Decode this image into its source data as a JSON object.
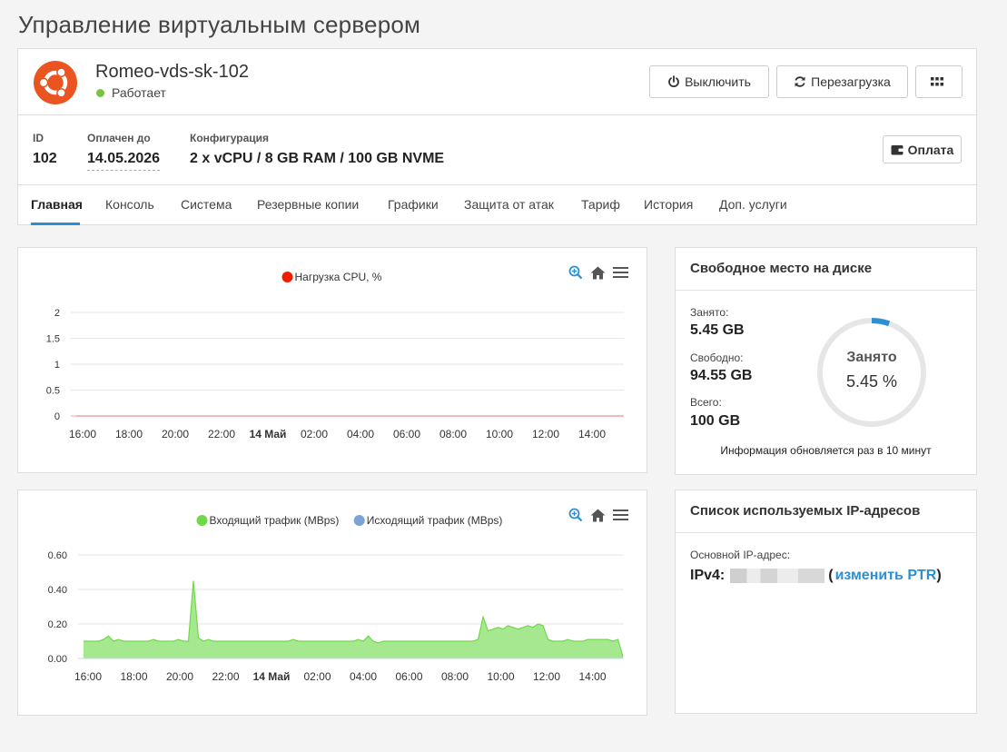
{
  "page": {
    "title": "Управление виртуальным сервером"
  },
  "server": {
    "name": "Romeo-vds-sk-102",
    "status": "Работает",
    "status_color": "#7cc142",
    "os_icon": "ubuntu-logo",
    "os_color": "#e95420"
  },
  "actions": {
    "power_off": "Выключить",
    "reboot": "Перезагрузка",
    "more_icon": "grid-icon",
    "pay": "Оплата"
  },
  "info": {
    "id_label": "ID",
    "id_value": "102",
    "paid_label": "Оплачен до",
    "paid_value": "14.05.2026",
    "config_label": "Конфигурация",
    "config_value": "2 x vCPU / 8 GB RAM / 100 GB NVME"
  },
  "tabs": [
    {
      "label": "Главная",
      "active": true
    },
    {
      "label": "Консоль"
    },
    {
      "label": "Система"
    },
    {
      "label": "Резервные копии"
    },
    {
      "label": "Графики"
    },
    {
      "label": "Защита от атак"
    },
    {
      "label": "Тариф"
    },
    {
      "label": "История"
    },
    {
      "label": "Доп. услуги"
    }
  ],
  "accent_color": "#2a8fd3",
  "chart_data": [
    {
      "type": "line",
      "series": [
        {
          "name": "Нагрузка CPU, %",
          "color": "#f21d00",
          "values": [
            0,
            0,
            0,
            0,
            0,
            0,
            0,
            0,
            0,
            0,
            0,
            0
          ]
        }
      ],
      "x": [
        "16:00",
        "18:00",
        "20:00",
        "22:00",
        "14 Май",
        "02:00",
        "04:00",
        "06:00",
        "08:00",
        "10:00",
        "12:00",
        "14:00"
      ],
      "yticks": [
        "0",
        "0.5",
        "1",
        "1.5",
        "2"
      ],
      "ylim": [
        0,
        2
      ],
      "legend": "top-center",
      "grid": true
    },
    {
      "type": "area",
      "series": [
        {
          "name": "Входящий трафик (MBps)",
          "color": "#6fd94a",
          "values": [
            0.1,
            0.1,
            0.1,
            0.1,
            0.11,
            0.13,
            0.1,
            0.11,
            0.1,
            0.1,
            0.1,
            0.1,
            0.1,
            0.1,
            0.11,
            0.1,
            0.1,
            0.1,
            0.1,
            0.11,
            0.1,
            0.1,
            0.45,
            0.12,
            0.1,
            0.11,
            0.1,
            0.1,
            0.1,
            0.1,
            0.1,
            0.1,
            0.1,
            0.1,
            0.1,
            0.1,
            0.1,
            0.1,
            0.1,
            0.1,
            0.1,
            0.1,
            0.11,
            0.1,
            0.1,
            0.1,
            0.1,
            0.1,
            0.1,
            0.1,
            0.1,
            0.1,
            0.1,
            0.1,
            0.1,
            0.11,
            0.1,
            0.13,
            0.1,
            0.09,
            0.1,
            0.1,
            0.1,
            0.1,
            0.1,
            0.1,
            0.1,
            0.1,
            0.1,
            0.1,
            0.1,
            0.1,
            0.1,
            0.1,
            0.1,
            0.1,
            0.1,
            0.1,
            0.1,
            0.11,
            0.24,
            0.16,
            0.17,
            0.18,
            0.17,
            0.19,
            0.18,
            0.17,
            0.18,
            0.19,
            0.18,
            0.2,
            0.19,
            0.11,
            0.1,
            0.1,
            0.1,
            0.11,
            0.1,
            0.1,
            0.1,
            0.11,
            0.11,
            0.11,
            0.11,
            0.11,
            0.1,
            0.11,
            0.01
          ]
        },
        {
          "name": "Исходящий трафик (MBps)",
          "color": "#7aa3d6",
          "values": []
        }
      ],
      "x": [
        "16:00",
        "18:00",
        "20:00",
        "22:00",
        "14 Май",
        "02:00",
        "04:00",
        "06:00",
        "08:00",
        "10:00",
        "12:00",
        "14:00"
      ],
      "yticks": [
        "0.00",
        "0.20",
        "0.40",
        "0.60"
      ],
      "ylim": [
        0,
        0.6
      ],
      "legend": "top-center",
      "grid": true
    }
  ],
  "disk": {
    "title": "Свободное место на диске",
    "used_label": "Занято:",
    "used_value": "5.45 GB",
    "free_label": "Свободно:",
    "free_value": "94.55 GB",
    "total_label": "Всего:",
    "total_value": "100 GB",
    "ring_label": "Занято",
    "ring_percent": "5.45 %",
    "ring_fraction": 0.0545,
    "note": "Информация обновляется раз в 10 минут"
  },
  "ip": {
    "title": "Список используемых IP-адресов",
    "main_label": "Основной IP-адрес:",
    "prefix": "IPv4:",
    "open_paren": "(",
    "link": "изменить PTR",
    "close_paren": ")"
  }
}
